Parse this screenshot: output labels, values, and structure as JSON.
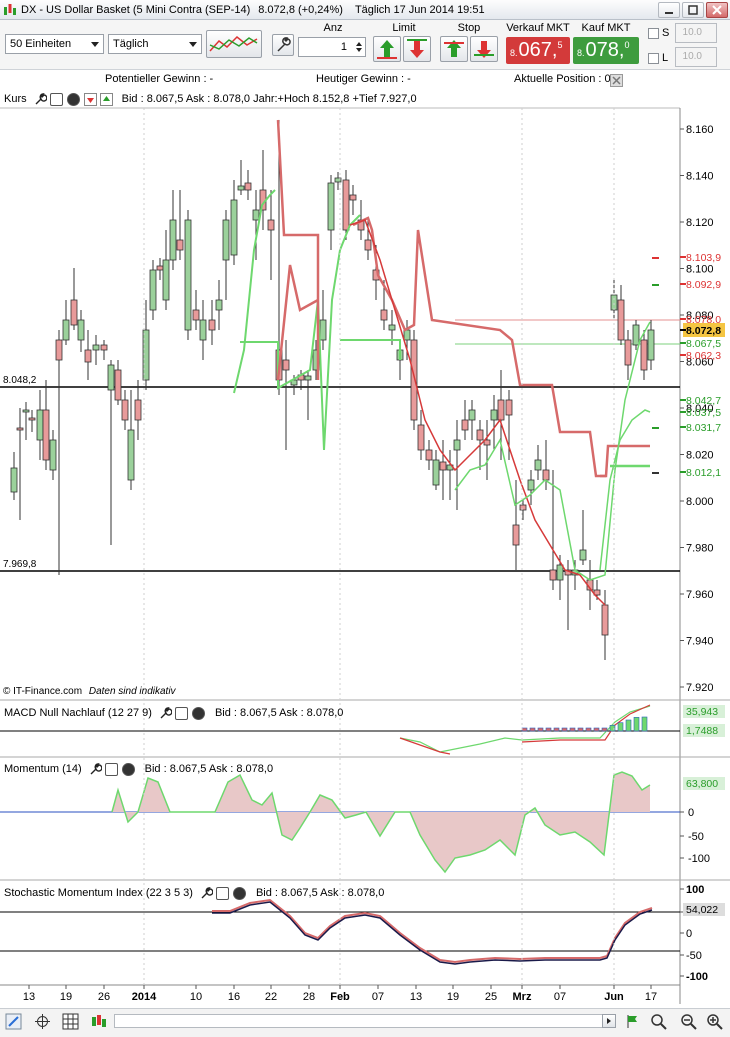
{
  "window": {
    "title": "DX - US Dollar Basket (5 Mini Contra (SEP-14)",
    "quote": "8.072,8 (+0,24%)",
    "period_date": "Täglich  17 Jun 2014 19:51"
  },
  "toolbar": {
    "units_select": "50 Einheiten",
    "period_select": "Täglich",
    "anz_label": "Anz",
    "anz_value": "1",
    "limit_label": "Limit",
    "stop_label": "Stop",
    "sell_label": "Verkauf MKT",
    "buy_label": "Kauf MKT",
    "sell_prefix": "8.",
    "sell_big": "067,",
    "sell_sup": "5",
    "buy_prefix": "8.",
    "buy_big": "078,",
    "buy_sup": "0",
    "s_label": "S",
    "l_label": "L",
    "s_value": "10.0",
    "l_value": "10.0",
    "sell_color": "#d33a3a",
    "buy_color": "#3e9c3e"
  },
  "info": {
    "potential": "Potentieller Gewinn : -",
    "today": "Heutiger Gewinn : -",
    "position": "Aktuelle Position : 0"
  },
  "price_panel": {
    "name": "Kurs",
    "bid_ask": "Bid : 8.067,5 Ask : 8.078,0 Jahr:+Hoch 8.152,8 +Tief 7.927,0",
    "footer": "© IT-Finance.com",
    "footer_italic": "Daten sind indikativ",
    "axis_ticks": [
      "8.160",
      "8.140",
      "8.120",
      "8.100",
      "8.080",
      "8.060",
      "8.040",
      "8.020",
      "8.000",
      "7.980",
      "7.960",
      "7.940",
      "7.920"
    ],
    "hline_labels": [
      "8.048,2",
      "7.969,8"
    ],
    "price_tags": [
      {
        "text": "8.103,9",
        "color": "#d33"
      },
      {
        "text": "8.092,9",
        "color": "#d33"
      },
      {
        "text": "8.078,0",
        "color": "#d33"
      },
      {
        "text": "8.072,8",
        "color": "#000",
        "bg": "#f5c542"
      },
      {
        "text": "8.067,5",
        "color": "#2a9d2a"
      },
      {
        "text": "8.062,3",
        "color": "#d33"
      },
      {
        "text": "8.042,7",
        "color": "#2a9d2a"
      },
      {
        "text": "8.037,5",
        "color": "#2a9d2a"
      },
      {
        "text": "8.031,7",
        "color": "#2a9d2a"
      },
      {
        "text": "8.012,1",
        "color": "#2a9d2a"
      }
    ]
  },
  "macd_panel": {
    "name": "MACD Null Nachlauf (12 27 9)",
    "bid_ask": "Bid : 8.067,5 Ask : 8.078,0",
    "tags": [
      "35,943",
      "1,7488"
    ]
  },
  "momentum_panel": {
    "name": "Momentum (14)",
    "bid_ask": "Bid : 8.067,5 Ask : 8.078,0",
    "tag": "63,800",
    "ticks": [
      "0",
      "-50",
      "-100"
    ]
  },
  "smi_panel": {
    "name": "Stochastic Momentum Index (22 3 5 3)",
    "bid_ask": "Bid : 8.067,5 Ask : 8.078,0",
    "tag": "54,022",
    "ticks": [
      "100",
      "50",
      "0",
      "-50",
      "-100"
    ]
  },
  "x_axis": [
    "13",
    "19",
    "26",
    "2014",
    "10",
    "16",
    "22",
    "28",
    "Feb",
    "07",
    "13",
    "19",
    "25",
    "Mrz",
    "07",
    "Jun",
    "17"
  ]
}
